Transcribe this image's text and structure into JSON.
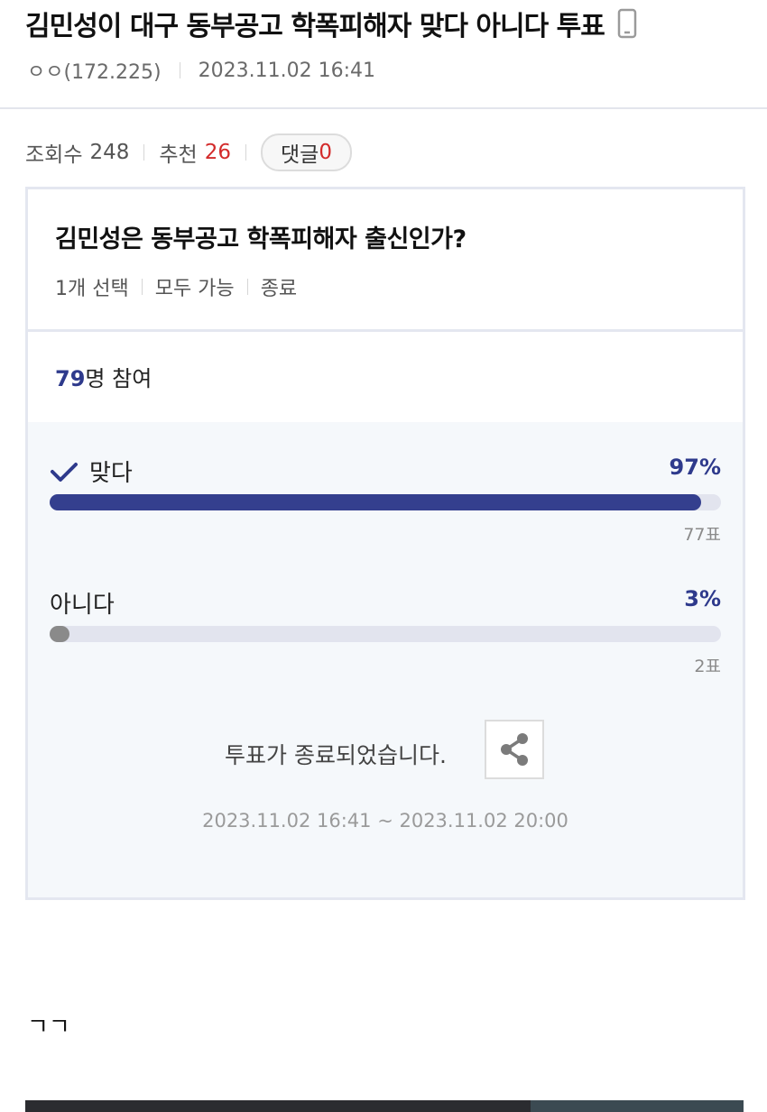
{
  "post": {
    "title": "김민성이 대구 동부공고 학폭피해자 맞다 아니다 투표",
    "author": "ㅇㅇ(172.225)",
    "datetime": "2023.11.02 16:41",
    "device_icon": "mobile-phone-icon"
  },
  "stats": {
    "views_label": "조회수",
    "views": "248",
    "recommend_label": "추천",
    "recommend": "26",
    "comments_label": "댓글",
    "comments": "0"
  },
  "poll": {
    "question": "김민성은 동부공고 학폭피해자 출신인가?",
    "options_meta": [
      "1개 선택",
      "모두 가능",
      "종료"
    ],
    "participants_count": "79",
    "participants_suffix": "명 참여",
    "items": [
      {
        "label": "맞다",
        "percent": "97%",
        "percent_value": 97,
        "votes": "77표",
        "selected": true
      },
      {
        "label": "아니다",
        "percent": "3%",
        "percent_value": 3,
        "votes": "2표",
        "selected": false
      }
    ],
    "closed_message": "투표가 종료되었습니다.",
    "period": "2023.11.02 16:41 ~ 2023.11.02 20:00",
    "share_icon": "share-icon"
  },
  "content": {
    "text": "ㄱㄱ"
  },
  "colors": {
    "accent": "#2e3a8c",
    "highlight": "#d32b2b",
    "winning_bar": "#343f8e",
    "losing_bar": "#8a8a8a",
    "bar_track": "#e2e4ee"
  }
}
